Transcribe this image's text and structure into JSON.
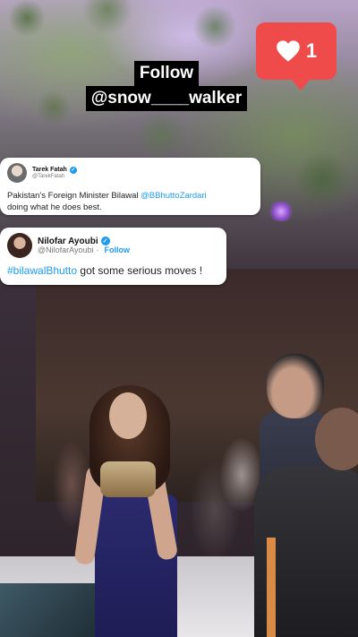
{
  "overlay": {
    "follow_line1": "Follow",
    "follow_line2": "@snow____walker"
  },
  "like_badge": {
    "icon": "heart-icon",
    "count": "1",
    "color": "#ef4b4b"
  },
  "tweets": [
    {
      "name": "Tarek Fatah",
      "handle": "@TarekFatah",
      "verified": true,
      "text_before": "Pakistan's Foreign Minister Bilawal ",
      "mention": "@BBhuttoZardari",
      "text_after": "doing what he does best."
    },
    {
      "name": "Nilofar Ayoubi",
      "handle": "@NilofarAyoubi",
      "follow_label": "Follow",
      "verified": true,
      "hashtag": "#bilawalBhutto",
      "text_after": " got some serious moves !"
    }
  ],
  "colors": {
    "accent_blue": "#1d9bf0"
  }
}
